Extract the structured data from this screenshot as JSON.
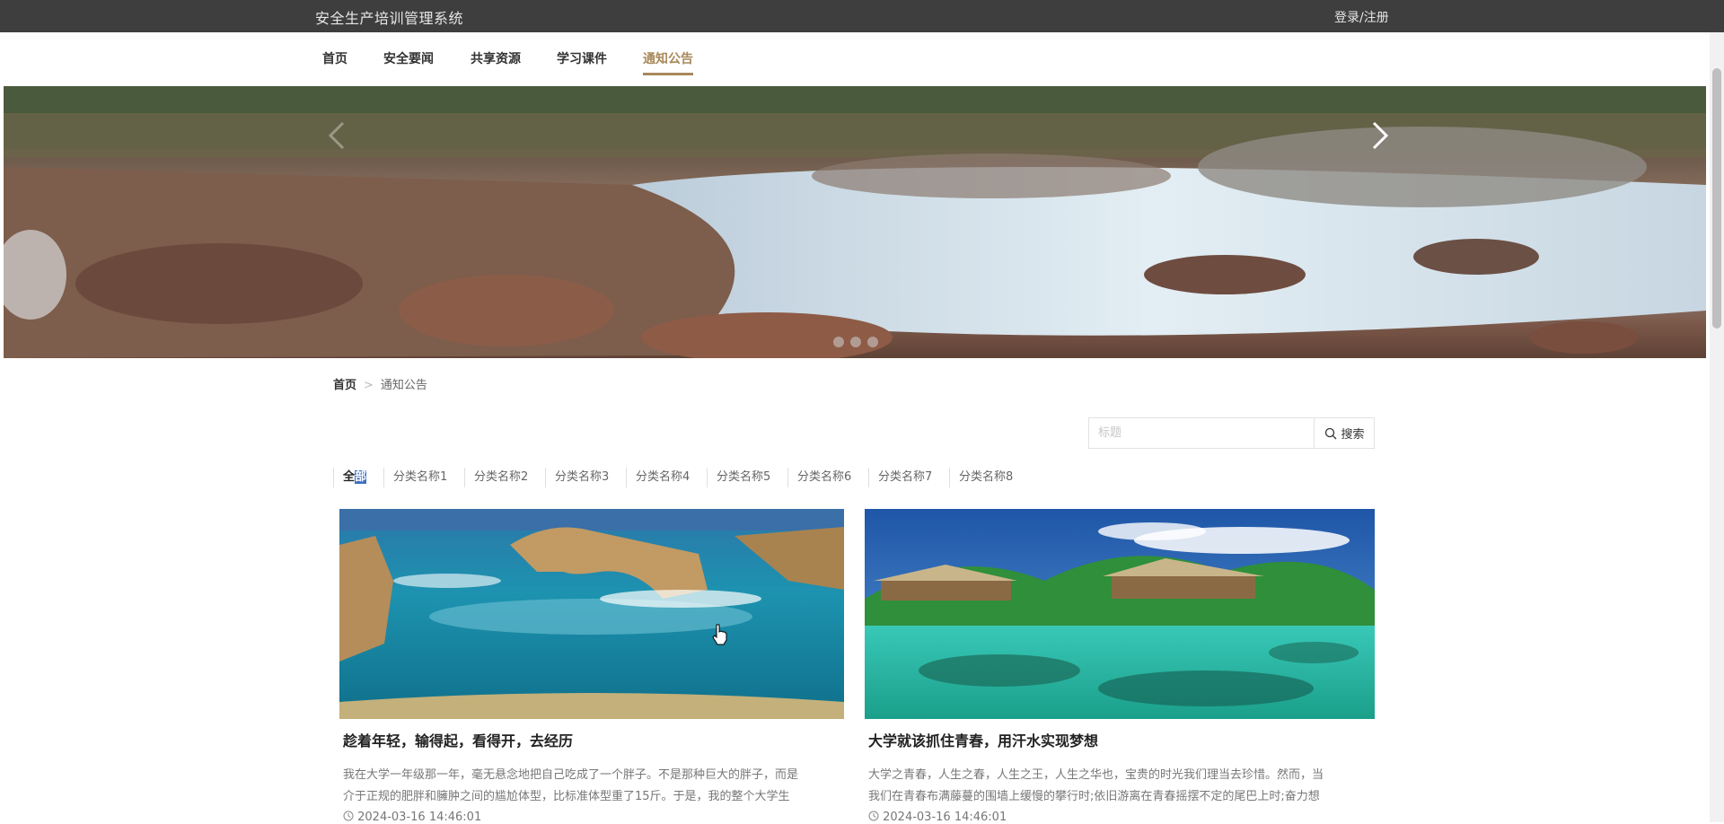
{
  "header": {
    "site_title": "安全生产培训管理系统",
    "login_label": "登录/注册"
  },
  "nav": {
    "items": [
      {
        "label": "首页"
      },
      {
        "label": "安全要闻"
      },
      {
        "label": "共享资源"
      },
      {
        "label": "学习课件"
      },
      {
        "label": "通知公告"
      }
    ],
    "active_index": 4,
    "active_color": "#a8885a"
  },
  "banner": {
    "prev_icon": "chevron-left-icon",
    "next_icon": "chevron-right-icon",
    "slide_count": 3
  },
  "breadcrumb": {
    "home": "首页",
    "separator": ">",
    "current": "通知公告"
  },
  "search": {
    "placeholder": "标题",
    "button_label": "搜索",
    "icon": "search-icon"
  },
  "categories": {
    "all_part1": "全",
    "all_part2": "部",
    "items": [
      "分类名称1",
      "分类名称2",
      "分类名称3",
      "分类名称4",
      "分类名称5",
      "分类名称6",
      "分类名称7",
      "分类名称8"
    ]
  },
  "articles": [
    {
      "title": "趁着年轻，输得起，看得开，去经历",
      "desc_line1": "我在大学一年级那一年，毫无悬念地把自己吃成了一个胖子。不是那种巨大的胖子，而是",
      "desc_line2": "介于正规的肥胖和臃肿之间的尴尬体型，比标准体型重了15斤。于是，我的整个大学生",
      "date": "2024-03-16 14:46:01"
    },
    {
      "title": "大学就该抓住青春，用汗水实现梦想",
      "desc_line1": "大学之青春，人生之春，人生之王，人生之华也，宝贵的时光我们理当去珍惜。然而，当",
      "desc_line2": "我们在青春布满藤蔓的围墙上缓慢的攀行时;依旧游离在青春摇摆不定的尾巴上时;奋力想",
      "date": "2024-03-16 14:46:01"
    }
  ]
}
